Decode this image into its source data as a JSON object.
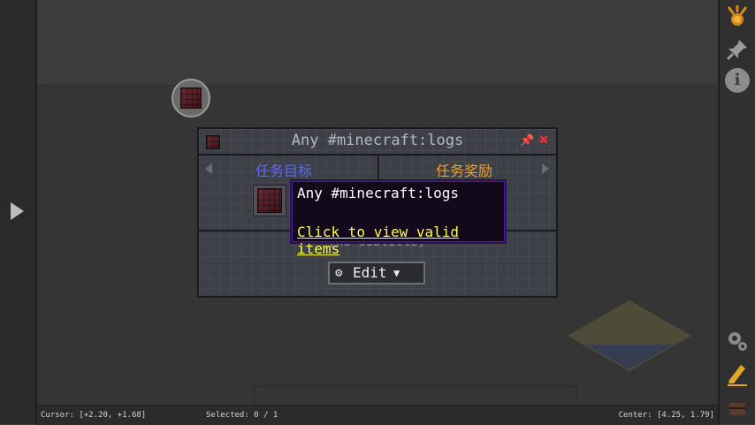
{
  "quest_panel": {
    "title": "Any #minecraft:logs",
    "tab_tasks": "任务目标",
    "tab_rewards": "任务奖励",
    "subtitle": "[no subtitle]",
    "edit_label": "Edit"
  },
  "tooltip": {
    "title": "Any #minecraft:logs",
    "link": "Click to view valid items"
  },
  "status_bar": {
    "cursor": "Cursor: [+2.20, +1.68]",
    "selected": "Selected: 0 / 1",
    "center": "Center: [4.25, 1.79]"
  },
  "icons": {
    "pin": "pin-icon",
    "close": "close-icon",
    "gear": "gear-icon",
    "info": "info-icon",
    "pencil": "pencil-icon",
    "medal": "medal-icon"
  },
  "colors": {
    "tab_tasks": "#5c67ff",
    "tab_rewards": "#f2a024",
    "close": "#e23232",
    "link": "#fffe3f"
  }
}
